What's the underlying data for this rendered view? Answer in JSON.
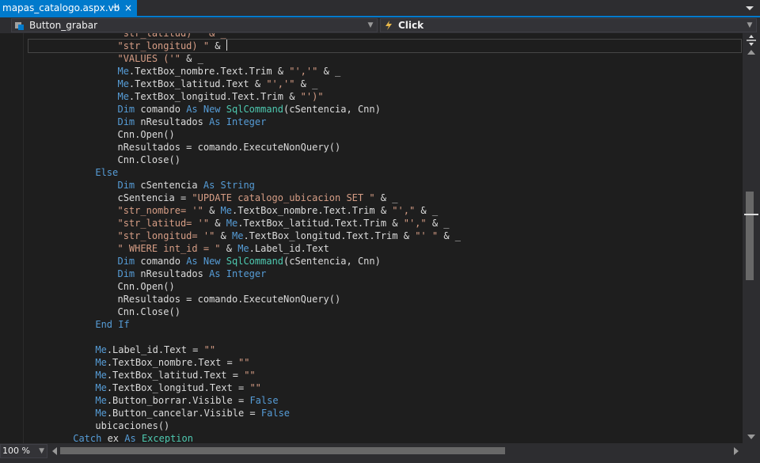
{
  "tab": {
    "title": "mapas_catalogo.aspx.vb",
    "pin_glyph": "⊣",
    "close_glyph": "×"
  },
  "navbar": {
    "object_name": "Button_grabar",
    "event_name": "Click"
  },
  "editor": {
    "lines": [
      [
        [
          "str",
          "\"str_latitud) \" & _"
        ]
      ],
      [
        [
          "str",
          "\"str_longitud) \""
        ],
        [
          "plain",
          " & "
        ]
      ],
      [
        [
          "str",
          "\"VALUES ('\""
        ],
        [
          "plain",
          " & _"
        ]
      ],
      [
        [
          "kw",
          "Me"
        ],
        [
          "plain",
          ".TextBox_nombre.Text.Trim & "
        ],
        [
          "str",
          "\"','\""
        ],
        [
          "plain",
          " & _"
        ]
      ],
      [
        [
          "kw",
          "Me"
        ],
        [
          "plain",
          ".TextBox_latitud.Text & "
        ],
        [
          "str",
          "\"','\""
        ],
        [
          "plain",
          " & _"
        ]
      ],
      [
        [
          "kw",
          "Me"
        ],
        [
          "plain",
          ".TextBox_longitud.Text.Trim & "
        ],
        [
          "str",
          "\"')\""
        ]
      ],
      [
        [
          "kw",
          "Dim"
        ],
        [
          "plain",
          " comando "
        ],
        [
          "kw",
          "As New"
        ],
        [
          "plain",
          " "
        ],
        [
          "type",
          "SqlCommand"
        ],
        [
          "plain",
          "(cSentencia, Cnn)"
        ]
      ],
      [
        [
          "kw",
          "Dim"
        ],
        [
          "plain",
          " nResultados "
        ],
        [
          "kw",
          "As"
        ],
        [
          "plain",
          " "
        ],
        [
          "kw",
          "Integer"
        ]
      ],
      [
        [
          "plain",
          "Cnn.Open()"
        ]
      ],
      [
        [
          "plain",
          "nResultados = comando.ExecuteNonQuery()"
        ]
      ],
      [
        [
          "plain",
          "Cnn.Close()"
        ]
      ],
      [
        [
          "kw",
          "Else"
        ]
      ],
      [
        [
          "kw",
          "Dim"
        ],
        [
          "plain",
          " cSentencia "
        ],
        [
          "kw",
          "As"
        ],
        [
          "plain",
          " "
        ],
        [
          "kw",
          "String"
        ]
      ],
      [
        [
          "plain",
          "cSentencia = "
        ],
        [
          "str",
          "\"UPDATE catalogo_ubicacion SET \""
        ],
        [
          "plain",
          " & _"
        ]
      ],
      [
        [
          "str",
          "\"str_nombre= '\""
        ],
        [
          "plain",
          " & "
        ],
        [
          "kw",
          "Me"
        ],
        [
          "plain",
          ".TextBox_nombre.Text.Trim & "
        ],
        [
          "str",
          "\"',\""
        ],
        [
          "plain",
          " & _"
        ]
      ],
      [
        [
          "str",
          "\"str_latitud= '\""
        ],
        [
          "plain",
          " & "
        ],
        [
          "kw",
          "Me"
        ],
        [
          "plain",
          ".TextBox_latitud.Text.Trim & "
        ],
        [
          "str",
          "\"',\""
        ],
        [
          "plain",
          " & _"
        ]
      ],
      [
        [
          "str",
          "\"str_longitud= '\""
        ],
        [
          "plain",
          " & "
        ],
        [
          "kw",
          "Me"
        ],
        [
          "plain",
          ".TextBox_longitud.Text.Trim & "
        ],
        [
          "str",
          "\"' \""
        ],
        [
          "plain",
          " & _"
        ]
      ],
      [
        [
          "str",
          "\" WHERE int_id = \""
        ],
        [
          "plain",
          " & "
        ],
        [
          "kw",
          "Me"
        ],
        [
          "plain",
          ".Label_id.Text"
        ]
      ],
      [
        [
          "kw",
          "Dim"
        ],
        [
          "plain",
          " comando "
        ],
        [
          "kw",
          "As New"
        ],
        [
          "plain",
          " "
        ],
        [
          "type",
          "SqlCommand"
        ],
        [
          "plain",
          "(cSentencia, Cnn)"
        ]
      ],
      [
        [
          "kw",
          "Dim"
        ],
        [
          "plain",
          " nResultados "
        ],
        [
          "kw",
          "As"
        ],
        [
          "plain",
          " "
        ],
        [
          "kw",
          "Integer"
        ]
      ],
      [
        [
          "plain",
          "Cnn.Open()"
        ]
      ],
      [
        [
          "plain",
          "nResultados = comando.ExecuteNonQuery()"
        ]
      ],
      [
        [
          "plain",
          "Cnn.Close()"
        ]
      ],
      [
        [
          "kw",
          "End If"
        ]
      ],
      [],
      [
        [
          "kw",
          "Me"
        ],
        [
          "plain",
          ".Label_id.Text = "
        ],
        [
          "str",
          "\"\""
        ]
      ],
      [
        [
          "kw",
          "Me"
        ],
        [
          "plain",
          ".TextBox_nombre.Text = "
        ],
        [
          "str",
          "\"\""
        ]
      ],
      [
        [
          "kw",
          "Me"
        ],
        [
          "plain",
          ".TextBox_latitud.Text = "
        ],
        [
          "str",
          "\"\""
        ]
      ],
      [
        [
          "kw",
          "Me"
        ],
        [
          "plain",
          ".TextBox_longitud.Text = "
        ],
        [
          "str",
          "\"\""
        ]
      ],
      [
        [
          "kw",
          "Me"
        ],
        [
          "plain",
          ".Button_borrar.Visible = "
        ],
        [
          "kw",
          "False"
        ]
      ],
      [
        [
          "kw",
          "Me"
        ],
        [
          "plain",
          ".Button_cancelar.Visible = "
        ],
        [
          "kw",
          "False"
        ]
      ],
      [
        [
          "plain",
          "ubicaciones()"
        ]
      ],
      [
        [
          "kw",
          "Catch"
        ],
        [
          "plain",
          " ex "
        ],
        [
          "kw",
          "As"
        ],
        [
          "plain",
          " "
        ],
        [
          "type",
          "Exception"
        ]
      ]
    ]
  },
  "statusbar": {
    "zoom": "100 %"
  },
  "colors": {
    "keyword": "#569cd6",
    "type": "#4ec9b0",
    "string": "#d69d85",
    "text": "#dcdcdc",
    "accent": "#007acc"
  }
}
